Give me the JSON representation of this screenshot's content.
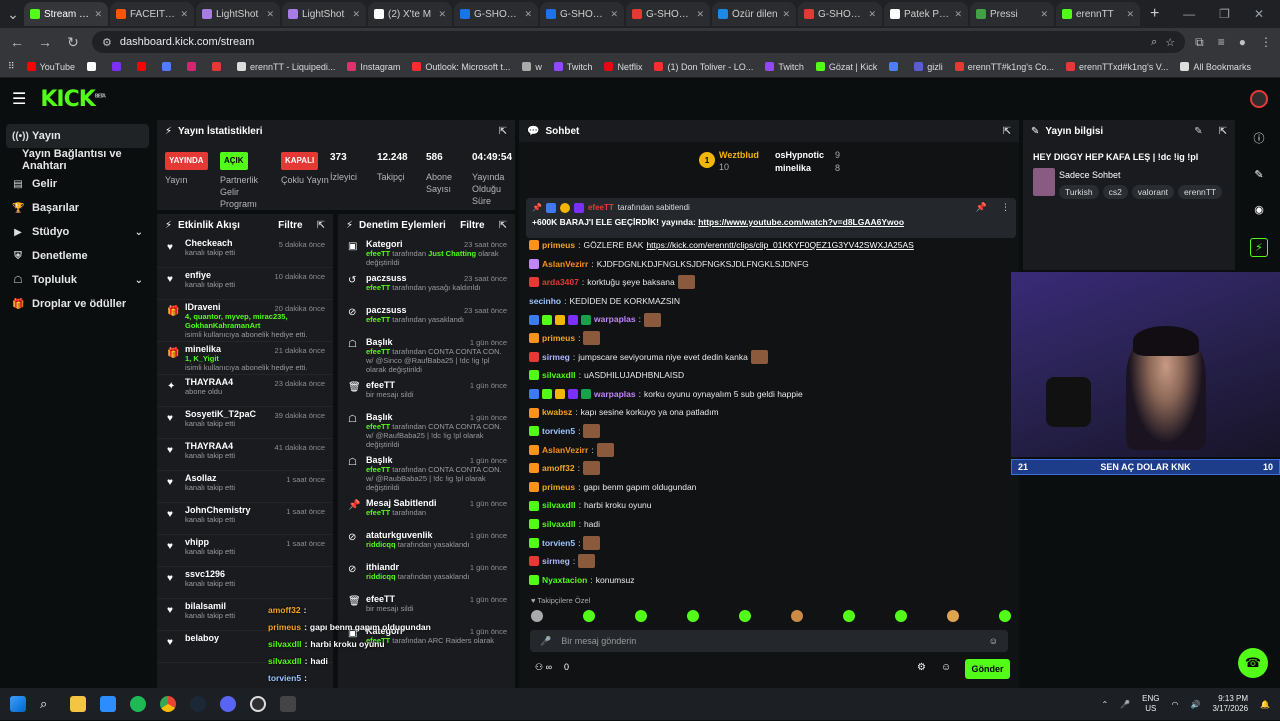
{
  "browser": {
    "tabs": [
      {
        "label": "Stream - Ki",
        "color": "#53fc18",
        "active": true
      },
      {
        "label": "FACEIT rele",
        "color": "#ff5500",
        "active": false
      },
      {
        "label": "LightShot",
        "color": "#a77ce6",
        "active": false
      },
      {
        "label": "LightShot",
        "color": "#a77ce6",
        "active": false
      },
      {
        "label": "(2) X'te M",
        "color": "#ffffff",
        "active": false
      },
      {
        "label": "G-SHOCK",
        "color": "#1a73e8",
        "active": false
      },
      {
        "label": "G-SHOCK",
        "color": "#1a73e8",
        "active": false
      },
      {
        "label": "G-SHOCK",
        "color": "#e53935",
        "active": false
      },
      {
        "label": "Özür dilen",
        "color": "#1e88e5",
        "active": false
      },
      {
        "label": "G-SHOCK",
        "color": "#e53935",
        "active": false
      },
      {
        "label": "Patek Phili",
        "color": "#ffffff",
        "active": false
      },
      {
        "label": "Pressi",
        "color": "#43a047",
        "active": false
      },
      {
        "label": "erennTT",
        "color": "#53fc18",
        "active": false
      }
    ],
    "url": "dashboard.kick.com/stream",
    "bookmarks": [
      "YouTube",
      "",
      "",
      "",
      "",
      "",
      "",
      "erennTT - Liquipedi...",
      "Instagram",
      "Outlook: Microsoft t...",
      "w",
      "Twitch",
      "Netflix",
      "(1) Don Toliver - LO...",
      "Twitch",
      "Gözat | Kick",
      "",
      "gizli",
      "erennTT#k1ng's Co...",
      "erennTTxd#k1ng's V...",
      "All Bookmarks"
    ]
  },
  "sidebar": {
    "items": [
      {
        "label": "Yayın",
        "icon": "broadcast-icon",
        "active": true
      },
      {
        "label": "Yayın Bağlantısı ve Anahtarı",
        "icon": "",
        "sub": true
      },
      {
        "label": "Gelir",
        "icon": "dollar-icon"
      },
      {
        "label": "Başarılar",
        "icon": "trophy-icon"
      },
      {
        "label": "Stüdyo",
        "icon": "studio-icon",
        "chevron": true
      },
      {
        "label": "Denetleme",
        "icon": "shield-icon"
      },
      {
        "label": "Topluluk",
        "icon": "community-icon",
        "chevron": true
      },
      {
        "label": "Droplar ve ödüller",
        "icon": "gift-icon"
      }
    ]
  },
  "stats": {
    "title": "Yayın İstatistikleri",
    "badges": [
      {
        "label": "YAYINDA",
        "caption": "Yayın",
        "bg": "#e53935"
      },
      {
        "label": "AÇIK",
        "caption": "Partnerlik Gelir Programı",
        "bg": "#53fc18"
      },
      {
        "label": "KAPALI",
        "caption": "Çoklu Yayın",
        "bg": "#e53935"
      }
    ],
    "values": [
      {
        "value": "373",
        "caption": "İzleyici"
      },
      {
        "value": "12.248",
        "caption": "Takipçi"
      },
      {
        "value": "586",
        "caption": "Abone Sayısı"
      },
      {
        "value": "04:49:54",
        "caption": "Yayında Olduğu Süre"
      }
    ]
  },
  "activity": {
    "title": "Etkinlik Akışı",
    "filter": "Filtre",
    "items": [
      {
        "name": "Checkeach",
        "sub": "kanalı takip etti",
        "time": "5 dakika önce",
        "icon": "heart"
      },
      {
        "name": "enfiye",
        "sub": "kanalı takip etti",
        "time": "10 dakika önce",
        "icon": "heart"
      },
      {
        "name": "IDraveni",
        "green": "4, quantor, myvep, mirac235, GokhanKahramanArt",
        "sub": "isimli kullanıcıya abonelik hediye etti.",
        "time": "20 dakika önce",
        "icon": "gift"
      },
      {
        "name": "minelika",
        "green": "1, K_Yigit",
        "sub": "isimli kullanıcıya abonelik hediye etti.",
        "time": "21 dakika önce",
        "icon": "gift"
      },
      {
        "name": "THAYRAA4",
        "sub": "abone oldu",
        "time": "23 dakika önce",
        "icon": "star"
      },
      {
        "name": "SosyetiK_T2paC",
        "sub": "kanalı takip etti",
        "time": "39 dakika önce",
        "icon": "heart"
      },
      {
        "name": "THAYRAA4",
        "sub": "kanalı takip etti",
        "time": "41 dakika önce",
        "icon": "heart"
      },
      {
        "name": "Asollaz",
        "sub": "kanalı takip etti",
        "time": "1 saat önce",
        "icon": "heart"
      },
      {
        "name": "JohnChemistry",
        "sub": "kanalı takip etti",
        "time": "1 saat önce",
        "icon": "heart"
      },
      {
        "name": "vhipp",
        "sub": "kanalı takip etti",
        "time": "1 saat önce",
        "icon": "heart"
      },
      {
        "name": "ssvc1296",
        "sub": "kanalı takip etti",
        "time": "",
        "icon": "heart"
      },
      {
        "name": "bilalsamil",
        "sub": "kanalı takip etti",
        "time": "",
        "icon": "heart"
      },
      {
        "name": "belaboy",
        "sub": "",
        "time": "",
        "icon": "heart"
      }
    ]
  },
  "moderation": {
    "title": "Denetim Eylemleri",
    "filter": "Filtre",
    "items": [
      {
        "title": "Kategori",
        "by": "efeeTT",
        "sub": "tarafından",
        "extra": "Just Chatting",
        "sub2": "olarak değiştirildi",
        "time": "23 saat önce",
        "icon": "category"
      },
      {
        "title": "paczsuss",
        "by": "efeeTT",
        "sub": "tarafından yasağı kaldırıldı",
        "time": "23 saat önce",
        "icon": "unban"
      },
      {
        "title": "paczsuss",
        "by": "efeeTT",
        "sub": "tarafından yasaklandı",
        "time": "23 saat önce",
        "icon": "ban"
      },
      {
        "title": "Başlık",
        "by": "efeeTT",
        "sub": "tarafından CONTA CONTA CON. w/ @Sinco @RaufBaba25 | !dc !ig !pl olarak değiştirildi",
        "time": "1 gün önce",
        "icon": "title"
      },
      {
        "title": "efeeTT",
        "by": "",
        "sub": "bir mesajı sildi",
        "time": "1 gün önce",
        "icon": "trash"
      },
      {
        "title": "Başlık",
        "by": "efeeTT",
        "sub": "tarafından CONTA CONTA CON. w/ @RaufBaba25 | !dc !ig !pl olarak değiştirildi",
        "time": "1 gün önce",
        "icon": "title"
      },
      {
        "title": "Başlık",
        "by": "efeeTT",
        "sub": "tarafından CONTA CONTA CON. w/ @RaubBaba25 | !dc !ig !pl olarak değiştirildi",
        "time": "1 gün önce",
        "icon": "title"
      },
      {
        "title": "Mesaj Sabitlendi",
        "by": "efeeTT",
        "sub": "tarafından",
        "time": "1 gün önce",
        "icon": "pin"
      },
      {
        "title": "ataturkguvenlik",
        "by": "riddicqq",
        "sub": "tarafından yasaklandı",
        "time": "1 gün önce",
        "icon": "ban"
      },
      {
        "title": "ithiandr",
        "by": "riddicqq",
        "sub": "tarafından yasaklandı",
        "time": "1 gün önce",
        "icon": "ban"
      },
      {
        "title": "efeeTT",
        "by": "",
        "sub": "bir mesajı sildi",
        "time": "1 gün önce",
        "icon": "trash"
      },
      {
        "title": "Kategori",
        "by": "efeeTT",
        "sub": "tarafından ARC Raiders olarak",
        "time": "1 gün önce",
        "icon": "category"
      }
    ]
  },
  "chat": {
    "title": "Sohbet",
    "top_gifters": [
      {
        "rank": "1",
        "name": "Weztblud",
        "count": "10"
      },
      {
        "name": "osHypnotic",
        "count": "9"
      },
      {
        "name": "minelika",
        "count": "8"
      }
    ],
    "pinned": {
      "by": "efeeTT",
      "by_suffix": "tarafından sabitlendi",
      "message": "+600K BARAJ'I ELE GEÇİRDİK! yayında:",
      "link": "https://www.youtube.com/watch?v=d8LGAA6Ywoo"
    },
    "messages": [
      {
        "user": "primeus",
        "color": "#f5a623",
        "text": "GÖZLERE BAK",
        "link": "https://kick.com/erenntt/clips/clip_01KKYF0QEZ1G3YV42SWXJA25AS"
      },
      {
        "user": "AslanVezirr",
        "color": "#f7931e",
        "text": "KJDFDGNLKDJFNGLKSJDFNGKSJDLFNGKLSJDNFG"
      },
      {
        "user": "arda3407",
        "color": "#e53935",
        "text": "korktuğu şeye baksana",
        "emote": true
      },
      {
        "user": "secinho",
        "color": "#9ec5ff",
        "text": "KEDİDEN DE KORKMAZSIN"
      },
      {
        "user": "warpaplas",
        "color": "#c084fc",
        "text": "",
        "emote": true
      },
      {
        "user": "primeus",
        "color": "#f5a623",
        "text": "",
        "emote": true
      },
      {
        "user": "sirmeg",
        "color": "#b0b6ff",
        "text": "jumpscare seviyoruma niye evet dedin kanka",
        "emote": true
      },
      {
        "user": "silvaxdll",
        "color": "#53fc18",
        "text": "uASDHILUJADHBNLAISD"
      },
      {
        "user": "warpaplas",
        "color": "#c084fc",
        "text": "korku oyunu oynayalım 5 sub geldi happie"
      },
      {
        "user": "kwabsz",
        "color": "#f5a623",
        "text": "kapı sesine korkuyo ya ona patladım"
      },
      {
        "user": "torvien5",
        "color": "#9ec5ff",
        "text": "",
        "emote": true
      },
      {
        "user": "AslanVezirr",
        "color": "#f7931e",
        "text": "",
        "emote": true
      },
      {
        "user": "amoff32",
        "color": "#f5a623",
        "text": "",
        "emote": true
      },
      {
        "user": "primeus",
        "color": "#f5a623",
        "text": "gapı benm gapım oldugundan"
      },
      {
        "user": "silvaxdll",
        "color": "#53fc18",
        "text": "harbi kroku oyunu"
      },
      {
        "user": "silvaxdll",
        "color": "#53fc18",
        "text": "hadi"
      },
      {
        "user": "torvien5",
        "color": "#9ec5ff",
        "text": "",
        "emote": true
      },
      {
        "user": "sirmeg",
        "color": "#b0b6ff",
        "text": "",
        "emote": true
      },
      {
        "user": "Nyaxtacion",
        "color": "#53fc18",
        "text": "konumsuz"
      }
    ],
    "followers_only": "Takipçilere Özel",
    "input_placeholder": "Bir mesaj gönderin",
    "counter": "0",
    "send_label": "Gönder"
  },
  "stream_info": {
    "title": "Yayın bilgisi",
    "stream_title": "HEY DIGGY HEP KAFA LEŞ | !dc !ig !pl",
    "category": "Sadece Sohbet",
    "tags": [
      "Turkish",
      "cs2",
      "valorant",
      "erennTT"
    ]
  },
  "poll": {
    "left": "21",
    "text": "SEN AÇ DOLAR KNK",
    "right": "10"
  },
  "overlay_chat": [
    {
      "user": "amoff32",
      "text": ""
    },
    {
      "user": "primeus",
      "text": "gapı benm gapım oldugundan"
    },
    {
      "user": "silvaxdll",
      "text": "harbi kroku oyunu"
    },
    {
      "user": "silvaxdll",
      "text": "hadi"
    },
    {
      "user": "torvien5",
      "text": ""
    },
    {
      "user": "sirmeg",
      "text": ""
    },
    {
      "user": "Nyaxtacion",
      "text": "konumsuz"
    }
  ],
  "taskbar": {
    "lang": "ENG",
    "region": "US",
    "time": "9:13 PM",
    "date": "3/17/2026"
  }
}
